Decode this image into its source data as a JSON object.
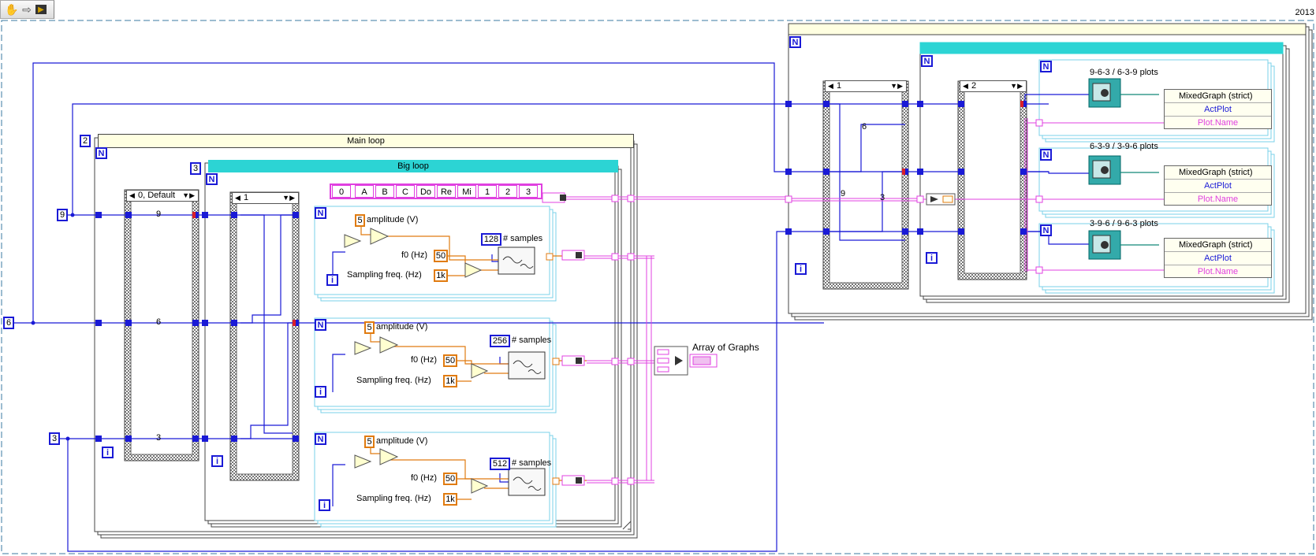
{
  "version": "2013",
  "toolbar": {
    "icons": [
      "hand-icon",
      "arrow-icon",
      "breakpoint-icon"
    ],
    "hand_glyph": "✋",
    "arrow_glyph": "⇨",
    "bp_glyph": "▶"
  },
  "constants": {
    "nine": "9",
    "six": "6",
    "three": "3",
    "two": "2",
    "three_b": "3"
  },
  "terminals": {
    "n": "N",
    "i": "i"
  },
  "main_loop": {
    "title": "Main loop",
    "case_selector": "0, Default",
    "wire_labels": [
      "9",
      "6",
      "3"
    ]
  },
  "big_loop": {
    "title": "Big loop",
    "case_selector": "1",
    "enum_index": "0",
    "enum_values": [
      "A",
      "B",
      "C",
      "Do",
      "Re",
      "Mi",
      "1",
      "2",
      "3"
    ]
  },
  "generators": [
    {
      "amplitude": "5",
      "amplitude_label": "amplitude (V)",
      "samples": "128",
      "samples_label": "# samples",
      "f0": "50",
      "f0_label": "f0 (Hz)",
      "fs": "1k",
      "fs_label": "Sampling freq. (Hz)"
    },
    {
      "amplitude": "5",
      "amplitude_label": "amplitude (V)",
      "samples": "256",
      "samples_label": "# samples",
      "f0": "50",
      "f0_label": "f0 (Hz)",
      "fs": "1k",
      "fs_label": "Sampling freq. (Hz)"
    },
    {
      "amplitude": "5",
      "amplitude_label": "amplitude (V)",
      "samples": "512",
      "samples_label": "# samples",
      "f0": "50",
      "f0_label": "f0 (Hz)",
      "fs": "1k",
      "fs_label": "Sampling freq. (Hz)"
    }
  ],
  "array_of_graphs_label": "Array of Graphs",
  "right_section": {
    "case1_selector": "1",
    "case2_selector": "2",
    "wire_labels": [
      "6",
      "9",
      "3"
    ],
    "plots": [
      {
        "title": "9-6-3 / 6-3-9 plots",
        "rows": [
          "MixedGraph (strict)",
          "ActPlot",
          "Plot.Name"
        ]
      },
      {
        "title": "6-3-9 / 3-9-6  plots",
        "rows": [
          "MixedGraph (strict)",
          "ActPlot",
          "Plot.Name"
        ]
      },
      {
        "title": "3-9-6 / 9-6-3 plots",
        "rows": [
          "MixedGraph (strict)",
          "ActPlot",
          "Plot.Name"
        ]
      }
    ]
  },
  "colors": {
    "int_wire": "#1a1ad6",
    "dbl_wire": "#e07b10",
    "cluster_wire": "#e040e0",
    "cyan": "#2cd4d4",
    "loop_title_bg": "#ffffe1"
  }
}
